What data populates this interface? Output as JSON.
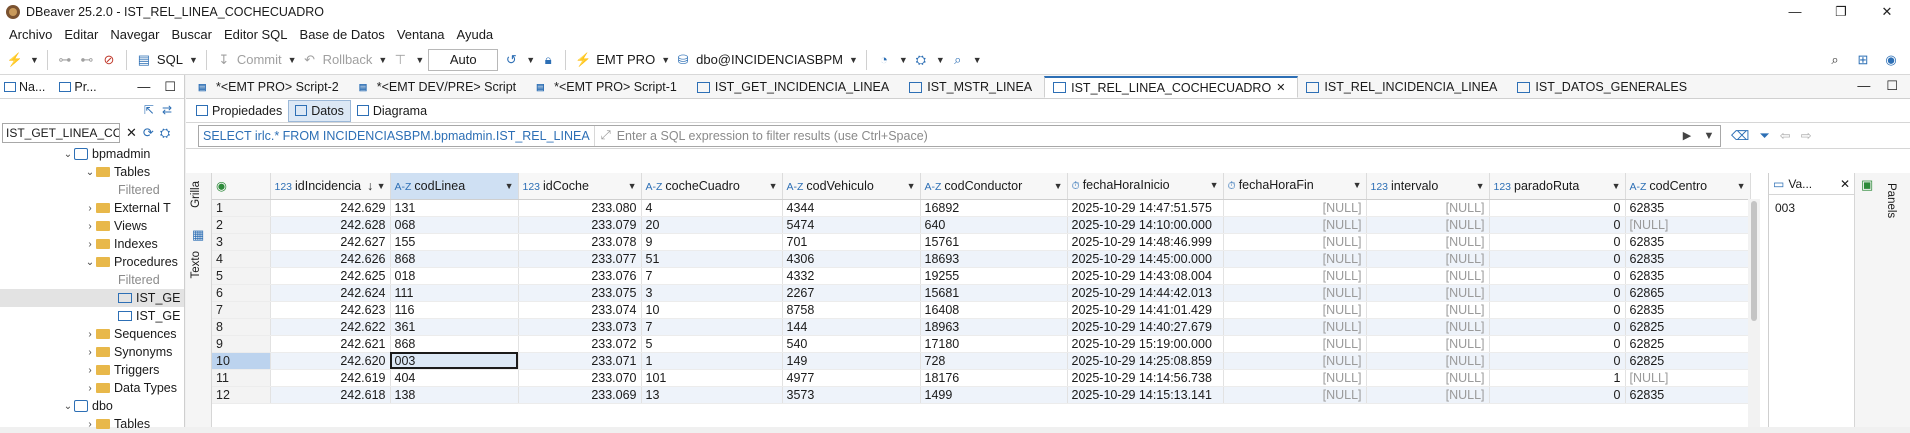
{
  "window": {
    "title": "DBeaver 25.2.0 - IST_REL_LINEA_COCHECUADRO",
    "controls": [
      "—",
      "❐",
      "✕"
    ]
  },
  "menu": [
    "Archivo",
    "Editar",
    "Navegar",
    "Buscar",
    "Editor SQL",
    "Base de Datos",
    "Ventana",
    "Ayuda"
  ],
  "toolbar": {
    "sql_label": "SQL",
    "commit_label": "Commit",
    "rollback_label": "Rollback",
    "auto_label": "Auto",
    "connection_label": "EMT PRO",
    "schema_label": "dbo@INCIDENCIASBPM"
  },
  "left_panel": {
    "tabs": [
      "Na...",
      "Pr..."
    ],
    "search_value": "IST_GET_LINEA_CC",
    "tree": [
      {
        "label": "bpmadmin",
        "indent": 1,
        "arrow": "⌄",
        "icon": "db"
      },
      {
        "label": "Tables",
        "indent": 2,
        "arrow": "⌄",
        "icon": "folder"
      },
      {
        "label": "Filtered",
        "indent": 3,
        "arrow": "",
        "icon": "none",
        "muted": true
      },
      {
        "label": "External T",
        "indent": 2,
        "arrow": "›",
        "icon": "folder"
      },
      {
        "label": "Views",
        "indent": 2,
        "arrow": "›",
        "icon": "folder"
      },
      {
        "label": "Indexes",
        "indent": 2,
        "arrow": "›",
        "icon": "folder"
      },
      {
        "label": "Procedures",
        "indent": 2,
        "arrow": "⌄",
        "icon": "folder"
      },
      {
        "label": "Filtered",
        "indent": 3,
        "arrow": "",
        "icon": "none",
        "muted": true
      },
      {
        "label": "IST_GE",
        "indent": 3,
        "arrow": "",
        "icon": "proc",
        "selected": true
      },
      {
        "label": "IST_GE",
        "indent": 3,
        "arrow": "",
        "icon": "proc"
      },
      {
        "label": "Sequences",
        "indent": 2,
        "arrow": "›",
        "icon": "folder"
      },
      {
        "label": "Synonyms",
        "indent": 2,
        "arrow": "›",
        "icon": "folder"
      },
      {
        "label": "Triggers",
        "indent": 2,
        "arrow": "›",
        "icon": "folder"
      },
      {
        "label": "Data Types",
        "indent": 2,
        "arrow": "›",
        "icon": "folder"
      },
      {
        "label": "dbo",
        "indent": 1,
        "arrow": "⌄",
        "icon": "db"
      },
      {
        "label": "Tables",
        "indent": 2,
        "arrow": "›",
        "icon": "folder"
      }
    ]
  },
  "editor_tabs": [
    {
      "label": "*<EMT PRO> Script-2",
      "icon": "sql",
      "active": false
    },
    {
      "label": "*<EMT DEV/PRE> Script",
      "icon": "sql",
      "active": false
    },
    {
      "label": "*<EMT PRO> Script-1",
      "icon": "sql",
      "active": false
    },
    {
      "label": "IST_GET_INCIDENCIA_LINEA",
      "icon": "proc",
      "active": false
    },
    {
      "label": "IST_MSTR_LINEA",
      "icon": "table",
      "active": false
    },
    {
      "label": "IST_REL_LINEA_COCHECUADRO",
      "icon": "table",
      "active": true
    },
    {
      "label": "IST_REL_INCIDENCIA_LINEA",
      "icon": "table",
      "active": false
    },
    {
      "label": "IST_DATOS_GENERALES",
      "icon": "table",
      "active": false
    }
  ],
  "sub_tabs": [
    "Propiedades",
    "Datos",
    "Diagrama"
  ],
  "filter": {
    "query": "SELECT irlc.* FROM INCIDENCIASBPM.bpmadmin.IST_REL_LINEA",
    "placeholder": "Enter a SQL expression to filter results (use Ctrl+Space)"
  },
  "side_tabs": [
    "Grilla",
    "Texto"
  ],
  "grid": {
    "columns": [
      {
        "type": "123",
        "name": "idIncidencia",
        "sort": "↓",
        "selected": false
      },
      {
        "type": "A-Z",
        "name": "codLinea",
        "sort": "",
        "selected": true
      },
      {
        "type": "123",
        "name": "idCoche",
        "sort": "",
        "selected": false
      },
      {
        "type": "A-Z",
        "name": "cocheCuadro",
        "sort": "",
        "selected": false
      },
      {
        "type": "A-Z",
        "name": "codVehiculo",
        "sort": "",
        "selected": false
      },
      {
        "type": "A-Z",
        "name": "codConductor",
        "sort": "",
        "selected": false
      },
      {
        "type": "⏱",
        "name": "fechaHoraInicio",
        "sort": "",
        "selected": false
      },
      {
        "type": "⏱",
        "name": "fechaHoraFin",
        "sort": "",
        "selected": false
      },
      {
        "type": "123",
        "name": "intervalo",
        "sort": "",
        "selected": false
      },
      {
        "type": "123",
        "name": "paradoRuta",
        "sort": "",
        "selected": false
      },
      {
        "type": "A-Z",
        "name": "codCentro",
        "sort": "",
        "selected": false
      }
    ],
    "rows": [
      [
        "1",
        "242.629",
        "131",
        "233.080",
        "4",
        "4344",
        "16892",
        "2025-10-29 14:47:51.575",
        "[NULL]",
        "[NULL]",
        "0",
        "62835"
      ],
      [
        "2",
        "242.628",
        "068",
        "233.079",
        "20",
        "5474",
        "640",
        "2025-10-29 14:10:00.000",
        "[NULL]",
        "[NULL]",
        "0",
        "[NULL]"
      ],
      [
        "3",
        "242.627",
        "155",
        "233.078",
        "9",
        "701",
        "15761",
        "2025-10-29 14:48:46.999",
        "[NULL]",
        "[NULL]",
        "0",
        "62835"
      ],
      [
        "4",
        "242.626",
        "868",
        "233.077",
        "51",
        "4306",
        "18693",
        "2025-10-29 14:45:00.000",
        "[NULL]",
        "[NULL]",
        "0",
        "62835"
      ],
      [
        "5",
        "242.625",
        "018",
        "233.076",
        "7",
        "4332",
        "19255",
        "2025-10-29 14:43:08.004",
        "[NULL]",
        "[NULL]",
        "0",
        "62835"
      ],
      [
        "6",
        "242.624",
        "111",
        "233.075",
        "3",
        "2267",
        "15681",
        "2025-10-29 14:44:42.013",
        "[NULL]",
        "[NULL]",
        "0",
        "62865"
      ],
      [
        "7",
        "242.623",
        "116",
        "233.074",
        "10",
        "8758",
        "16408",
        "2025-10-29 14:41:01.429",
        "[NULL]",
        "[NULL]",
        "0",
        "62835"
      ],
      [
        "8",
        "242.622",
        "361",
        "233.073",
        "7",
        "144",
        "18963",
        "2025-10-29 14:40:27.679",
        "[NULL]",
        "[NULL]",
        "0",
        "62825"
      ],
      [
        "9",
        "242.621",
        "868",
        "233.072",
        "5",
        "540",
        "17180",
        "2025-10-29 15:19:00.000",
        "[NULL]",
        "[NULL]",
        "0",
        "62825"
      ],
      [
        "10",
        "242.620",
        "003",
        "233.071",
        "1",
        "149",
        "728",
        "2025-10-29 14:25:08.859",
        "[NULL]",
        "[NULL]",
        "0",
        "62825"
      ],
      [
        "11",
        "242.619",
        "404",
        "233.070",
        "101",
        "4977",
        "18176",
        "2025-10-29 14:14:56.738",
        "[NULL]",
        "[NULL]",
        "1",
        "[NULL]"
      ],
      [
        "12",
        "242.618",
        "138",
        "233.069",
        "13",
        "3573",
        "1499",
        "2025-10-29 14:15:13.141",
        "[NULL]",
        "[NULL]",
        "0",
        "62835"
      ]
    ],
    "current_row": 10,
    "selected_cell_col": 2
  },
  "value_panel": {
    "title": "Va...",
    "value": "003",
    "side_label": "Panels"
  }
}
